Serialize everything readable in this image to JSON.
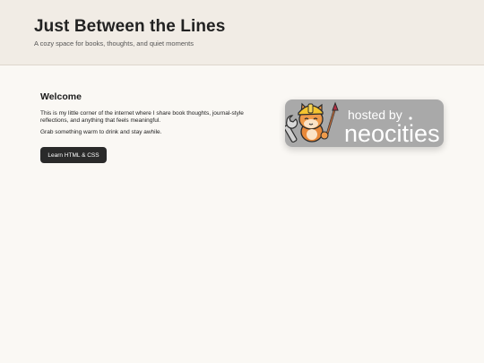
{
  "header": {
    "title": "Just Between the Lines",
    "tagline": "A cozy space for books, thoughts, and quiet moments"
  },
  "main": {
    "heading": "Welcome",
    "intro": "This is my little corner of the internet where I share book thoughts, journal-style reflections, and anything that feels meaningful.",
    "invite": "Grab something warm to drink and stay awhile.",
    "cta_label": "Learn HTML & CSS"
  },
  "badge": {
    "hosted_by": "hosted by",
    "brand": "neocities",
    "icon": "neocities-cat-icon"
  },
  "colors": {
    "header_bg": "#f1ece5",
    "page_bg": "#faf8f4",
    "button_bg": "#2a2a2a",
    "badge_bg": "#a9a9a9"
  }
}
